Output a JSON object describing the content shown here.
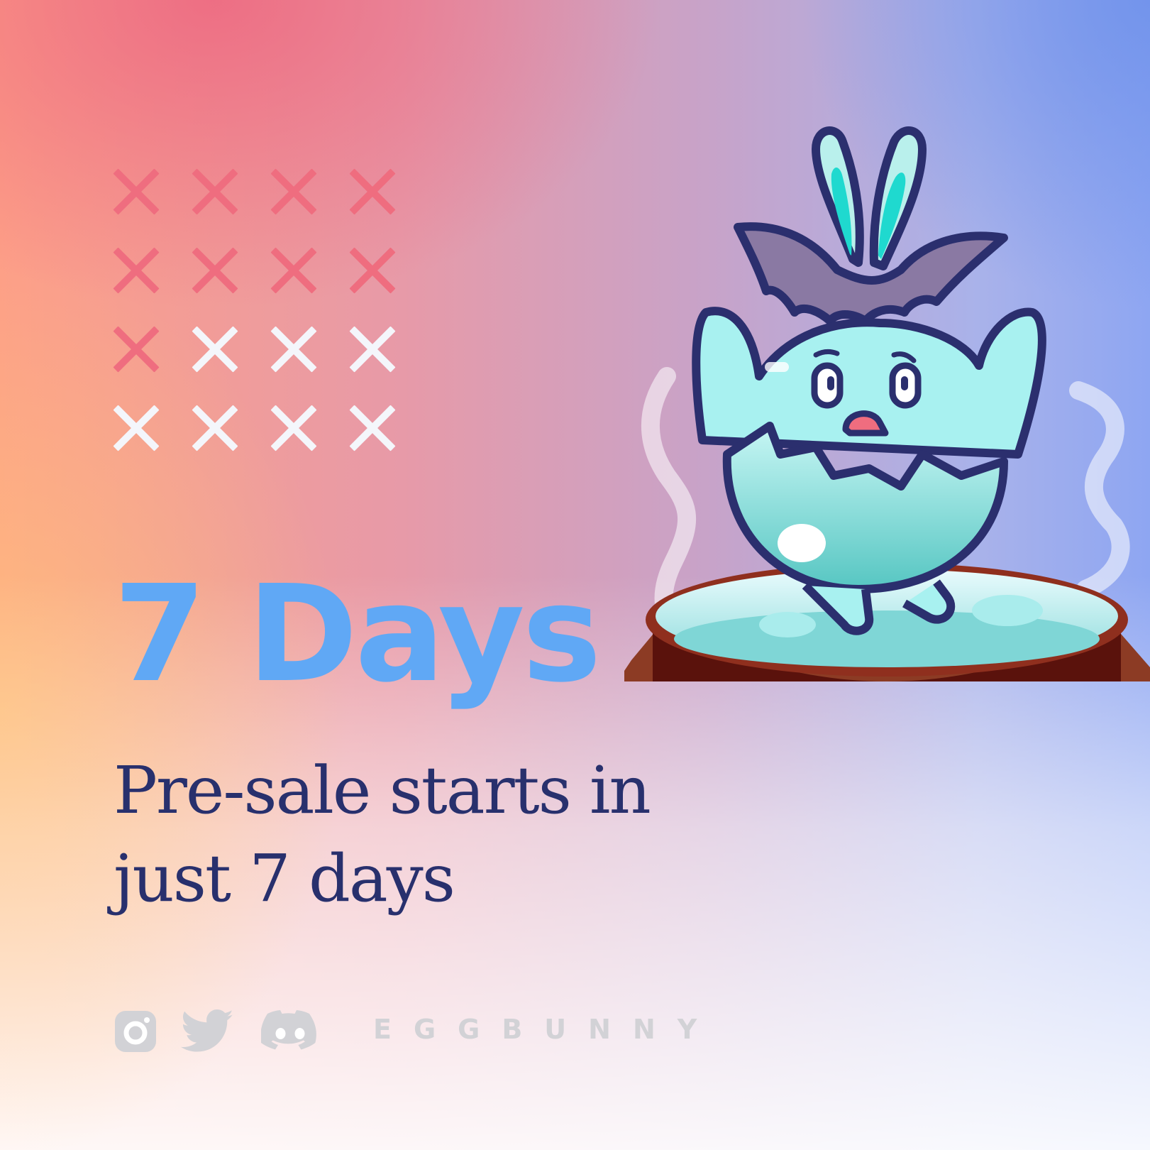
{
  "headline": "7 Days",
  "subtitle_line1": "Pre-sale starts in",
  "subtitle_line2": "just 7 days",
  "brand": "EGGBUNNY",
  "social_icons": [
    "instagram-icon",
    "twitter-icon",
    "discord-icon"
  ],
  "countdown": {
    "total": 16,
    "crossed": 9
  },
  "colors": {
    "headline": "#60a8f5",
    "subtitle": "#28306d",
    "cross_done": "#ef6d7f",
    "cross_remaining": "#f4f6fb",
    "brand": "#d2d2d6"
  }
}
